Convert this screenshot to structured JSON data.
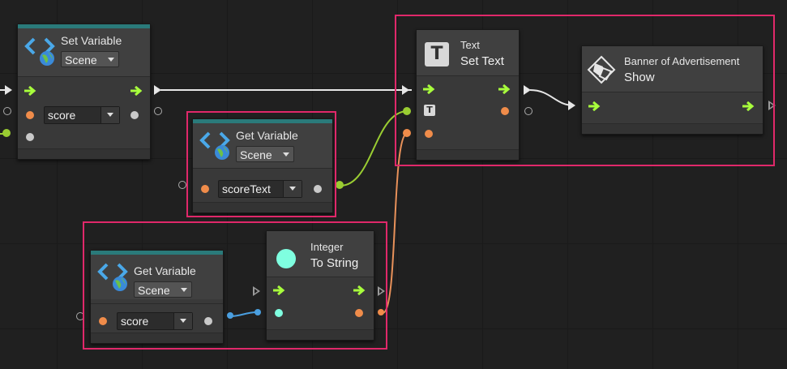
{
  "nodes": {
    "set_variable": {
      "title": "Set Variable",
      "scope": "Scene",
      "variable": "score"
    },
    "get_variable_text": {
      "title": "Get Variable",
      "scope": "Scene",
      "variable": "scoreText"
    },
    "get_variable_score": {
      "title": "Get Variable",
      "scope": "Scene",
      "variable": "score"
    },
    "integer_to_string": {
      "category": "Integer",
      "title": "To String"
    },
    "text_set_text": {
      "category": "Text",
      "title": "Set Text"
    },
    "banner_show": {
      "category": "Banner of Advertisement",
      "title": "Show"
    }
  },
  "colors": {
    "highlight": "#e0286a",
    "flow_arrow": "#a8ff3c",
    "string_port": "#f08c4a",
    "object_port": "#9acd32",
    "int_port": "#7fffe0",
    "generic_port": "#c9c9c9",
    "node_topbar": "#2a7a7a"
  },
  "icons": {
    "variable": "code-brackets-globe-icon",
    "text": "letter-t-icon",
    "integer": "cyan-circle-icon",
    "banner": "banner-ad-icon",
    "flow": "green-arrow-icon"
  }
}
